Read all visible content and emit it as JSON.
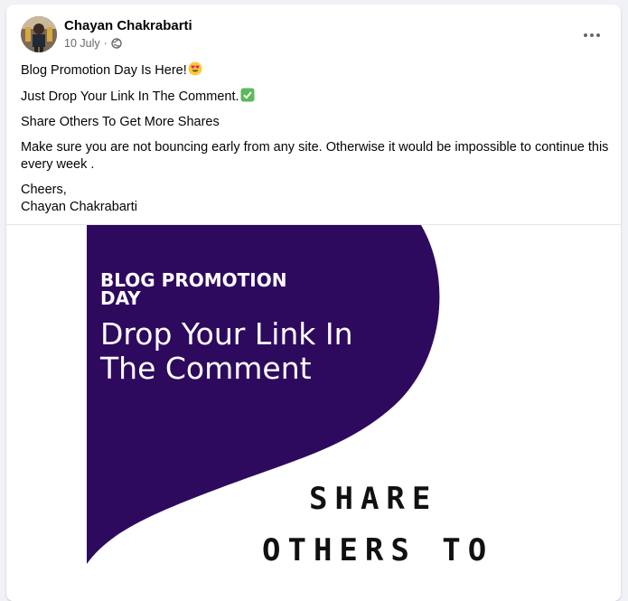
{
  "post": {
    "author": "Chayan Chakrabarti",
    "date": "10 July",
    "separator": "·",
    "audience_icon": "globe-icon",
    "more_icon": "ellipsis-icon",
    "lines": [
      "Blog Promotion Day Is Here!",
      "Just Drop Your Link In The Comment.",
      "Share Others To Get More Shares",
      "Make sure you are not bouncing early from any site. Otherwise it would be impossible to continue this every week .",
      "Cheers,",
      "Chayan Chakrabarti"
    ],
    "line_emojis": [
      "heart-eyes-emoji",
      "check-mark-emoji"
    ]
  },
  "image": {
    "heading": "BLOG PROMOTION",
    "heading2": "DAY",
    "sub1": "Drop Your Link In",
    "sub2": "The Comment",
    "share1": "SHARE",
    "share2": "OTHERS TO",
    "accent_color": "#2e0a5e"
  }
}
